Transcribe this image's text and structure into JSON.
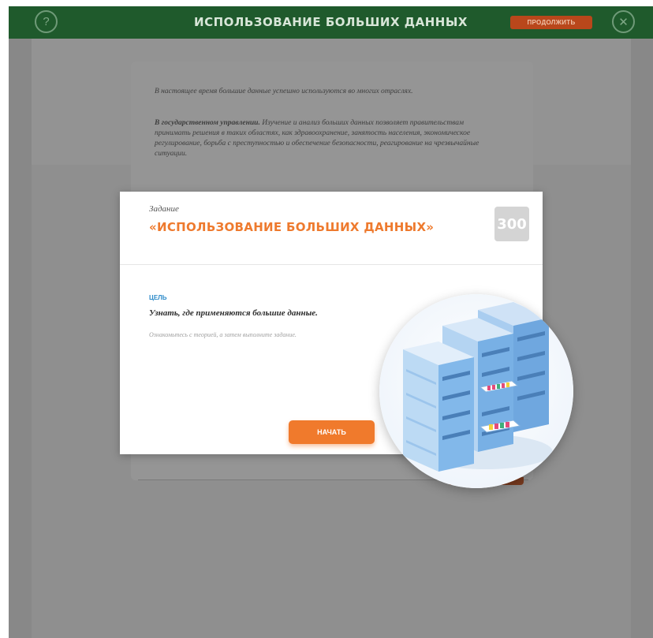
{
  "topbar": {
    "title": "ИСПОЛЬЗОВАНИЕ БОЛЬШИХ ДАННЫХ",
    "continue_label": "ПРОДОЛЖИТЬ",
    "help_icon": "question-icon",
    "close_icon": "close-icon"
  },
  "article": {
    "para1": "В настоящее время большие данные успешно используются во многих отраслях.",
    "para2_bold": "В государственном управлении.",
    "para2_text": " Изучение и анализ больших данных позволяет правительствам принимать решения в таких областях, как здравоохранение, занятость населения, экономическое регулирование, борьба с преступностью и обеспечение безопасности, реагирование на чрезвычайные ситуации."
  },
  "modal": {
    "task_label": "Задание",
    "task_title": "«ИСПОЛЬЗОВАНИЕ БОЛЬШИХ ДАННЫХ»",
    "score": "300",
    "goal_label": "ЦЕЛЬ",
    "goal_text": "Узнать, где применяются большие данные.",
    "hint_text": "Ознакомьтесь с теорией, а затем выполните задание.",
    "start_label": "НАЧАТЬ",
    "illustration_icon": "server-rack-icon"
  },
  "colors": {
    "topbar": "#1f5a2c",
    "accent": "#f07a2c",
    "goal": "#2d8bc9",
    "server_blue": "#7fb3e6"
  }
}
